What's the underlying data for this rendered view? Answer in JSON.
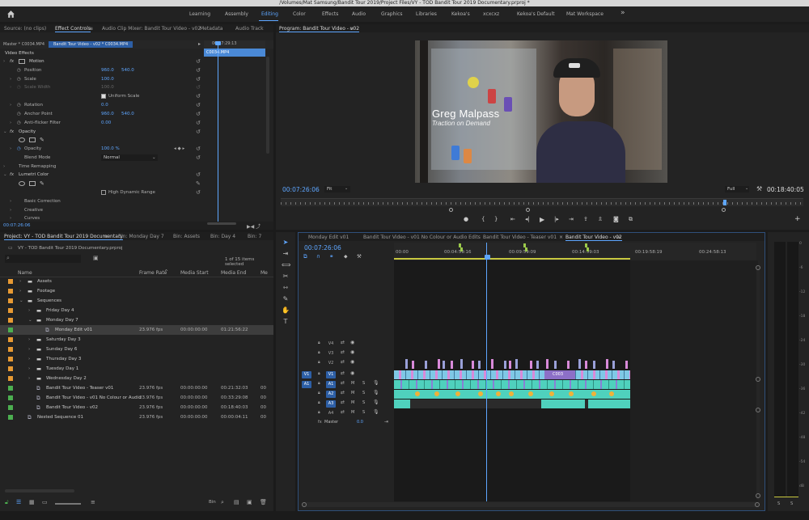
{
  "title_bar": "/Volumes/Mat Samsung/Bandit Tour 2019/Project Files/VY - TOD Bandit Tour 2019 Documentary.prproj *",
  "workspaces": [
    "Learning",
    "Assembly",
    "Editing",
    "Color",
    "Effects",
    "Audio",
    "Graphics",
    "Libraries",
    "Kekoa's",
    "xcxcxz",
    "Kekoa's Default",
    "Mat Workspace"
  ],
  "more_icon": "»",
  "source_tabs": [
    "Source: (no clips)",
    "Effect Controls",
    "Audio Clip Mixer: Bandit Tour Video - v02",
    "Metadata",
    "Audio Track"
  ],
  "effect_controls": {
    "master": "Master * C0034.MP4",
    "clip_path": "Bandit Tour Video - v02 * C0034.MP4",
    "ruler_time": "00:07:29:13",
    "clip_name": "C0034.MP4",
    "section": "Video Effects",
    "rows": [
      {
        "fx": "fx",
        "name": "Motion",
        "v1": "",
        "v2": ""
      },
      {
        "fx": "",
        "name": "Position",
        "v1": "960.0",
        "v2": "540.0"
      },
      {
        "fx": "",
        "name": "Scale",
        "v1": "100.0",
        "v2": ""
      },
      {
        "fx": "",
        "name": "Scale Width",
        "v1": "100.0",
        "v2": ""
      },
      {
        "fx": "",
        "name": "",
        "v1": "Uniform Scale",
        "v2": ""
      },
      {
        "fx": "",
        "name": "Rotation",
        "v1": "0.0",
        "v2": ""
      },
      {
        "fx": "",
        "name": "Anchor Point",
        "v1": "960.0",
        "v2": "540.0"
      },
      {
        "fx": "",
        "name": "Anti-flicker Filter",
        "v1": "0.00",
        "v2": ""
      },
      {
        "fx": "fx",
        "name": "Opacity",
        "v1": "",
        "v2": ""
      },
      {
        "fx": "",
        "name": "",
        "v1": "",
        "v2": ""
      },
      {
        "fx": "",
        "name": "Opacity",
        "v1": "100.0 %",
        "v2": ""
      },
      {
        "fx": "",
        "name": "Blend Mode",
        "v1": "Normal",
        "v2": ""
      },
      {
        "fx": "",
        "name": "Time Remapping",
        "v1": "",
        "v2": ""
      },
      {
        "fx": "fx",
        "name": "Lumetri Color",
        "v1": "",
        "v2": ""
      },
      {
        "fx": "",
        "name": "",
        "v1": "",
        "v2": ""
      },
      {
        "fx": "",
        "name": "",
        "v1": "High Dynamic Range",
        "v2": ""
      },
      {
        "fx": "",
        "name": "Basic Correction",
        "v1": "",
        "v2": ""
      },
      {
        "fx": "",
        "name": "Creative",
        "v1": "",
        "v2": ""
      },
      {
        "fx": "",
        "name": "Curves",
        "v1": "",
        "v2": ""
      }
    ],
    "timecode": "00:07:26:06"
  },
  "program": {
    "tab": "Program: Bandit Tour Video - v02",
    "lower_third_name": "Greg Malpass",
    "lower_third_sub": "Traction on Demand",
    "timecode": "00:07:26:06",
    "fit": "Fit",
    "quality": "Full",
    "duration": "00:18:40:05"
  },
  "project": {
    "tabs": [
      "Project: VY - TOD Bandit Tour 2019 Documentary",
      "Bin: Monday Day 7",
      "Bin: Assets",
      "Bin: Day 4",
      "Bin: 7"
    ],
    "file": "VY - TOD Bandit Tour 2019 Documentary.prproj",
    "selected_count": "1 of 15 items selected",
    "columns": [
      "Name",
      "Frame Rate",
      "Media Start",
      "Media End",
      "Me"
    ],
    "rows": [
      {
        "indent": 0,
        "name": "Assets",
        "fr": "",
        "ms": "",
        "me": "",
        "color": "#e89a33",
        "type": "folder",
        "tri": "›"
      },
      {
        "indent": 0,
        "name": "Footage",
        "fr": "",
        "ms": "",
        "me": "",
        "color": "#e89a33",
        "type": "folder",
        "tri": "›"
      },
      {
        "indent": 0,
        "name": "Sequences",
        "fr": "",
        "ms": "",
        "me": "",
        "color": "#e89a33",
        "type": "folder",
        "tri": "⌄"
      },
      {
        "indent": 1,
        "name": "Friday Day 4",
        "fr": "",
        "ms": "",
        "me": "",
        "color": "#e89a33",
        "type": "folder",
        "tri": "›"
      },
      {
        "indent": 1,
        "name": "Monday Day 7",
        "fr": "",
        "ms": "",
        "me": "",
        "color": "#e89a33",
        "type": "folder",
        "tri": "⌄"
      },
      {
        "indent": 2,
        "name": "Monday Edit v01",
        "fr": "23.976 fps",
        "ms": "00:00:00:00",
        "me": "01:21:56:22",
        "color": "#4caf50",
        "type": "seq",
        "tri": "",
        "sel": true
      },
      {
        "indent": 1,
        "name": "Saturday Day 3",
        "fr": "",
        "ms": "",
        "me": "",
        "color": "#e89a33",
        "type": "folder",
        "tri": "›"
      },
      {
        "indent": 1,
        "name": "Sunday Day 6",
        "fr": "",
        "ms": "",
        "me": "",
        "color": "#e89a33",
        "type": "folder",
        "tri": "›"
      },
      {
        "indent": 1,
        "name": "Thursday Day 3",
        "fr": "",
        "ms": "",
        "me": "",
        "color": "#e89a33",
        "type": "folder",
        "tri": "›"
      },
      {
        "indent": 1,
        "name": "Tuesday Day 1",
        "fr": "",
        "ms": "",
        "me": "",
        "color": "#e89a33",
        "type": "folder",
        "tri": "›"
      },
      {
        "indent": 1,
        "name": "Wednesday Day 2",
        "fr": "",
        "ms": "",
        "me": "",
        "color": "#e89a33",
        "type": "folder",
        "tri": "›"
      },
      {
        "indent": 1,
        "name": "Bandit Tour Video - Teaser v01",
        "fr": "23.976 fps",
        "ms": "00:00:00:00",
        "me": "00:21:32:03",
        "color": "#4caf50",
        "type": "seq",
        "tri": "",
        "m2": "00"
      },
      {
        "indent": 1,
        "name": "Bandit Tour Video - v01 No Colour or Audio",
        "fr": "23.976 fps",
        "ms": "00:00:00:00",
        "me": "00:33:29:08",
        "color": "#4caf50",
        "type": "seq",
        "tri": "",
        "m2": "00"
      },
      {
        "indent": 1,
        "name": "Bandit Tour Video - v02",
        "fr": "23.976 fps",
        "ms": "00:00:00:00",
        "me": "00:18:40:03",
        "color": "#4caf50",
        "type": "seq",
        "tri": "",
        "m2": "00"
      },
      {
        "indent": 0,
        "name": "Nested Sequence 01",
        "fr": "23.976 fps",
        "ms": "00:00:00:00",
        "me": "00:00:04:11",
        "color": "#4caf50",
        "type": "seq",
        "tri": "",
        "m2": "00"
      }
    ]
  },
  "timeline": {
    "tabs": [
      "Monday Edit v01",
      "Bandit Tour Video - v01 No Colour or Audio Edits",
      "Bandit Tour Video - Teaser v01",
      "Bandit Tour Video - v02"
    ],
    "timecode": "00:07:26:06",
    "ruler": [
      "00:00",
      "00:04:59:16",
      "00:09:59:09",
      "00:14:59:03",
      "00:19:58:19",
      "00:24:58:13"
    ],
    "video_tracks": [
      "V4",
      "V3",
      "V2",
      "V1"
    ],
    "audio_tracks": [
      "A1",
      "A2",
      "A3",
      "A4"
    ],
    "master_label": "Master",
    "master_value": "0.0",
    "clip_title": "C003",
    "src_v": "V1",
    "src_a": "A1"
  },
  "meter_scale": [
    "0",
    "-6",
    "-12",
    "-18",
    "-24",
    "-30",
    "-36",
    "-42",
    "-48",
    "-54",
    "dB"
  ],
  "meter_labels": [
    "S",
    "S"
  ],
  "colors": {
    "accent": "#5ea6ff",
    "video_clip": "#7fc8e6",
    "pink_clip": "#d98ad9",
    "audio_clip": "#4fd1bd",
    "folder": "#e89a33",
    "sequence": "#4caf50"
  }
}
